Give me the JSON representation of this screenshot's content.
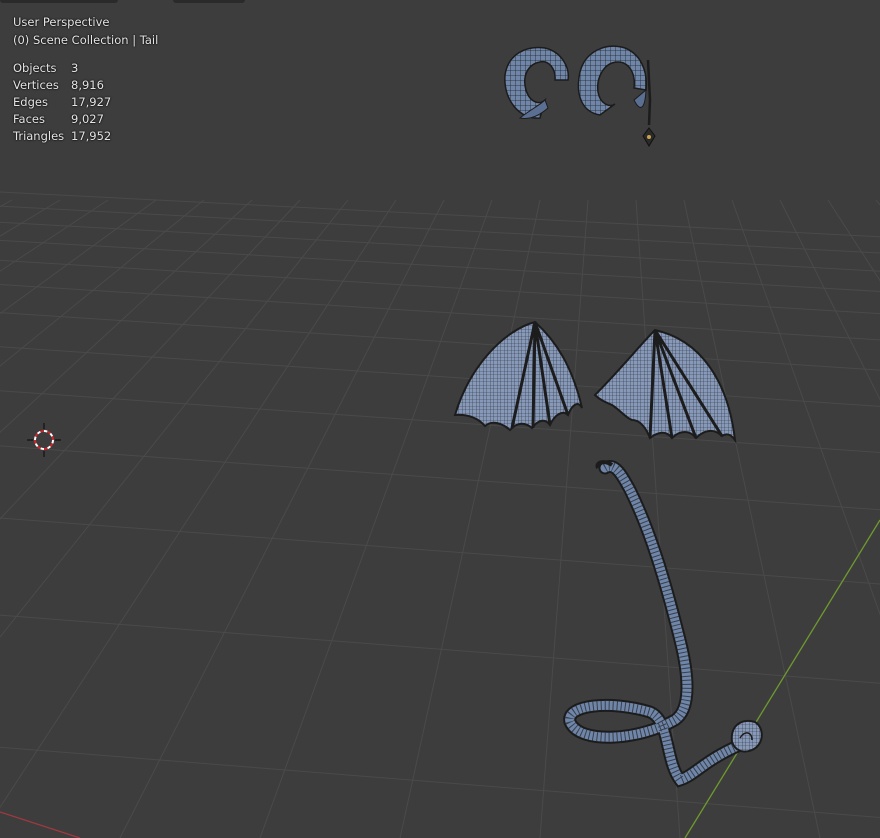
{
  "viewport": {
    "view_name": "User Perspective",
    "collection_line": "(0) Scene Collection | Tail",
    "stats": [
      {
        "label": "Objects",
        "value": "3"
      },
      {
        "label": "Vertices",
        "value": "8,916"
      },
      {
        "label": "Edges",
        "value": "17,927"
      },
      {
        "label": "Faces",
        "value": "9,027"
      },
      {
        "label": "Triangles",
        "value": "17,952"
      }
    ],
    "colors": {
      "background": "#3d3d3d",
      "grid": "#4a4a4a",
      "x_axis": "#a0393f",
      "y_axis": "#6e9a2e",
      "mesh_fill": "#6f86a8",
      "mesh_wire": "#1c1c1c"
    },
    "objects": [
      "horns",
      "wings",
      "tail"
    ]
  }
}
